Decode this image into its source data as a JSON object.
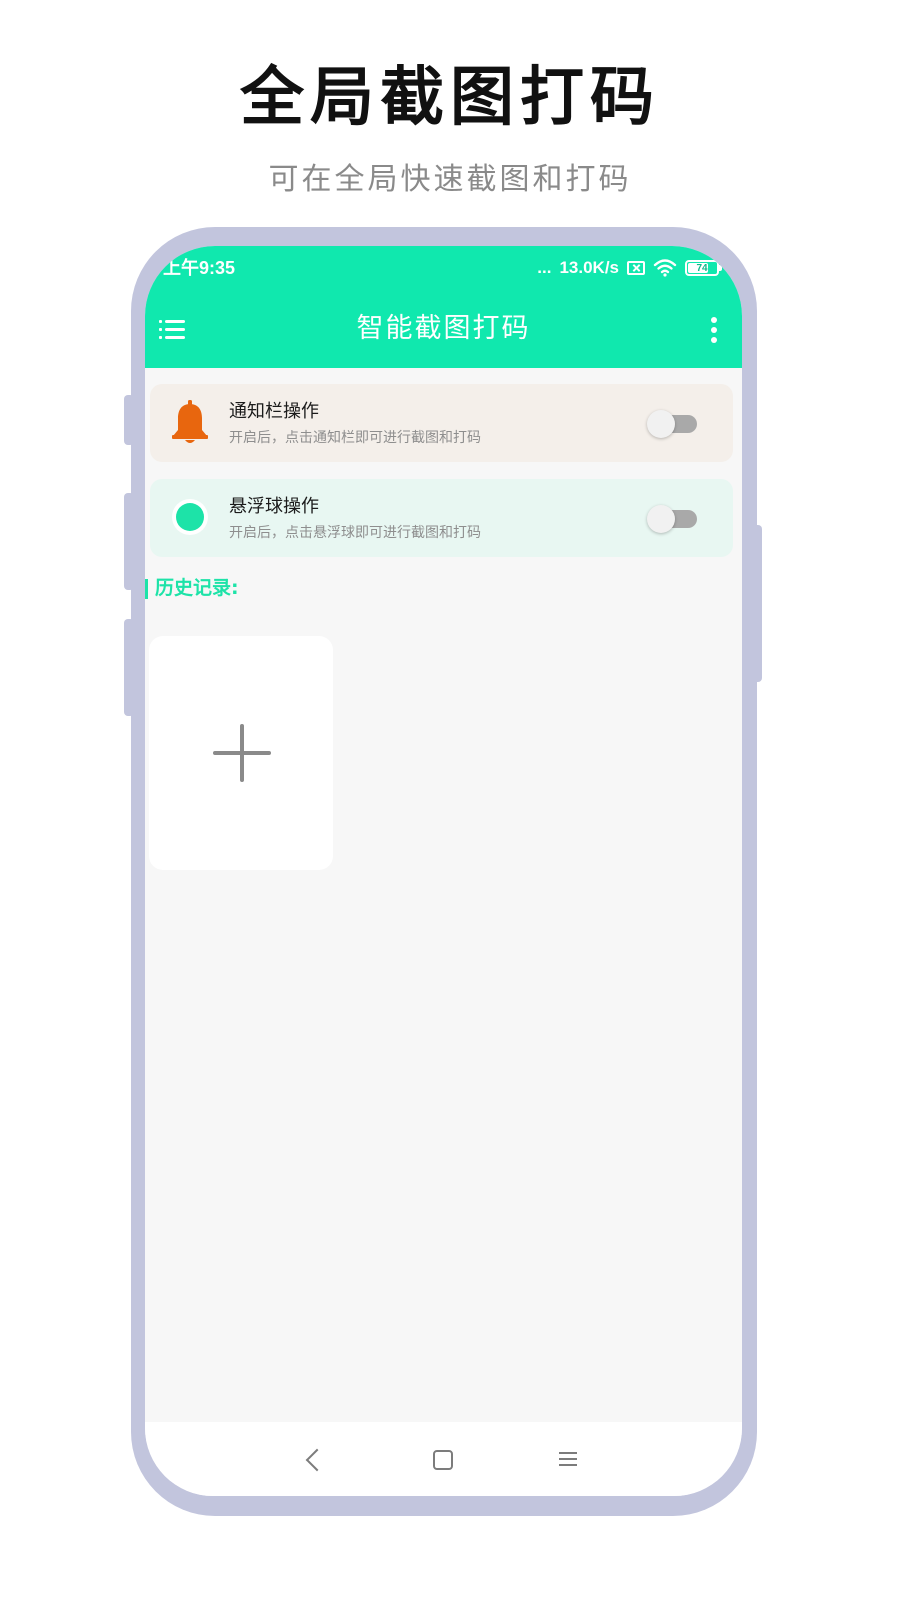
{
  "hero": {
    "title": "全局截图打码",
    "subtitle": "可在全局快速截图和打码"
  },
  "status_bar": {
    "time": "上午9:35",
    "signal": "...",
    "network_speed": "13.0K/s",
    "battery_level": "74",
    "icons": [
      "no-sim-icon",
      "wifi-icon",
      "battery-icon"
    ]
  },
  "toolbar": {
    "title": "智能截图打码",
    "left_icon": "menu-list-icon",
    "right_icon": "more-vertical-icon"
  },
  "settings": {
    "notify": {
      "title": "通知栏操作",
      "description": "开启后，点击通知栏即可进行截图和打码",
      "icon": "bell-icon",
      "enabled": false
    },
    "float": {
      "title": "悬浮球操作",
      "description": "开启后，点击悬浮球即可进行截图和打码",
      "icon": "floating-ball-icon",
      "enabled": false
    }
  },
  "history": {
    "label": "历史记录:",
    "add_icon": "plus-icon"
  },
  "nav": {
    "buttons": [
      "back-icon",
      "home-icon",
      "recents-icon"
    ]
  },
  "colors": {
    "accent": "#10e8ae",
    "frame": "#c2c5dd",
    "bell": "#e8660e",
    "notify_card": "#f4efea",
    "float_card": "#e8f7f2"
  }
}
